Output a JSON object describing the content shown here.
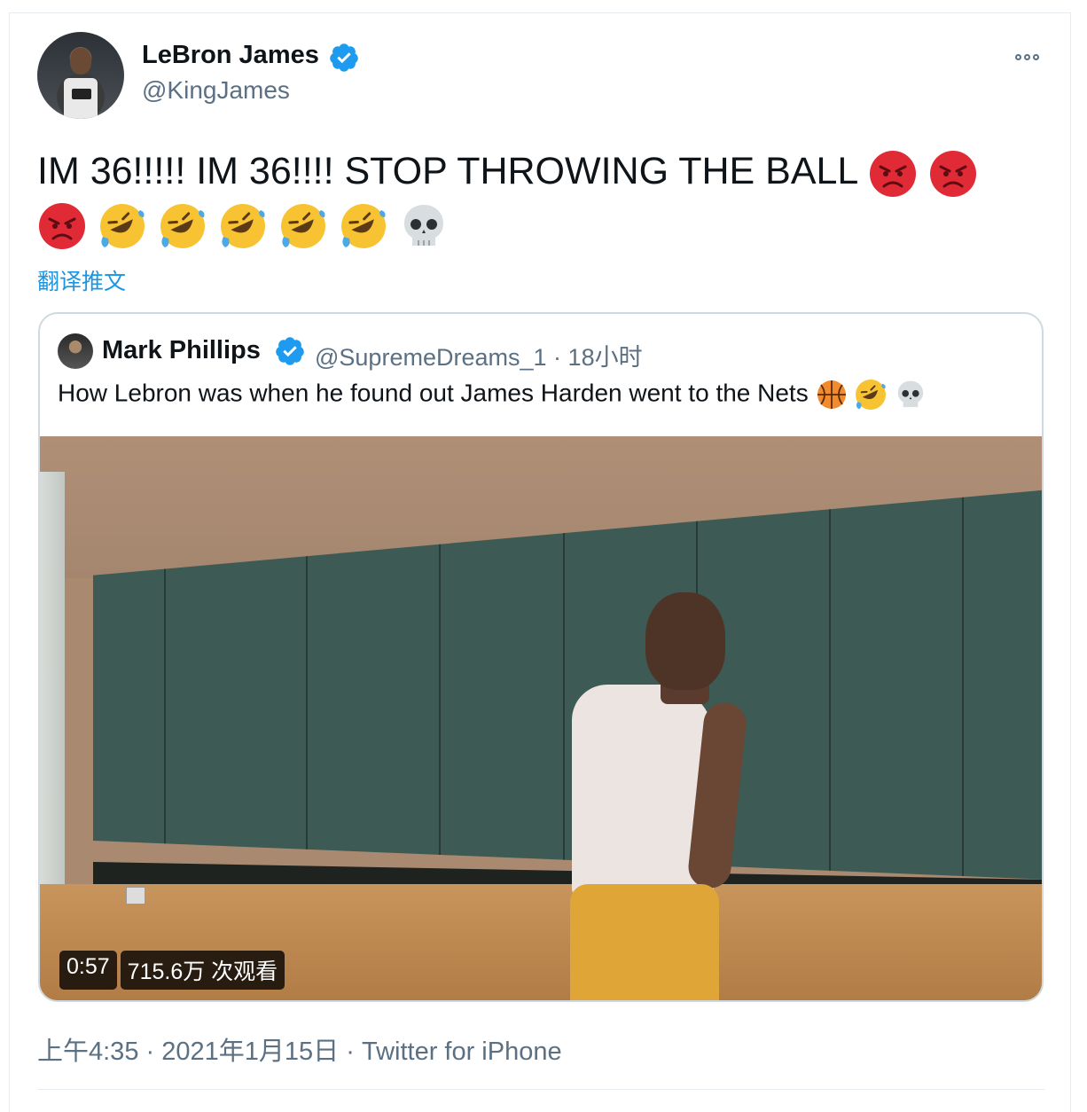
{
  "author": {
    "name": "LeBron James",
    "handle": "@KingJames"
  },
  "tweet": {
    "text_main": "IM 36!!!!! IM 36!!!! STOP THROWING THE BALL",
    "emojis_line1": [
      "angry-face",
      "angry-face"
    ],
    "emojis_line2": [
      "angry-face",
      "rolling-laughing",
      "rolling-laughing",
      "rolling-laughing",
      "rolling-laughing",
      "rolling-laughing",
      "skull"
    ],
    "translate_label": "翻译推文"
  },
  "quoted": {
    "name": "Mark Phillips",
    "handle": "@SupremeDreams_1",
    "separator": "·",
    "time_ago": "18小时",
    "text": "How Lebron was when he found out James Harden went to the Nets",
    "emojis": [
      "basketball",
      "rolling-laughing",
      "skull"
    ],
    "video": {
      "duration": "0:57",
      "views": "715.6万 次观看"
    }
  },
  "footer": {
    "time": "上午4:35",
    "sep1": "·",
    "date": "2021年1月15日",
    "sep2": "·",
    "source": "Twitter for iPhone"
  },
  "colors": {
    "link": "#1b95e0",
    "secondary_text": "#5b7083",
    "verified": "#1d9bf0"
  }
}
